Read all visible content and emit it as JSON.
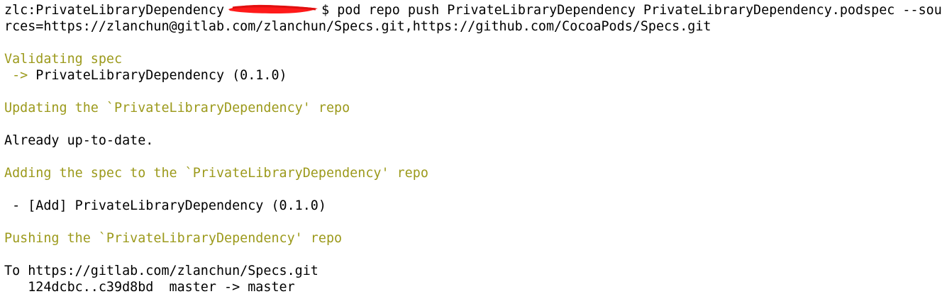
{
  "colors": {
    "background": "#ffffff",
    "text": "#000000",
    "status_text": "#9c9a1c",
    "redaction": "#ff1a1a"
  },
  "prompt": {
    "prefix": "zlc:PrivateLibraryDependency ",
    "suffix": "$ pod repo push PrivateLibraryDependency PrivateLibraryDependency.podspec --sou"
  },
  "lines": {
    "l2": "rces=https://zlanchun@gitlab.com/zlanchun/Specs.git,https://github.com/CocoaPods/Specs.git",
    "l4": "Validating spec",
    "l5_arrow": " ->",
    "l5_text": " PrivateLibraryDependency (0.1.0)",
    "l7": "Updating the `PrivateLibraryDependency' repo",
    "l9": "Already up-to-date.",
    "l11": "Adding the spec to the `PrivateLibraryDependency' repo",
    "l13": " - [Add] PrivateLibraryDependency (0.1.0)",
    "l15": "Pushing the `PrivateLibraryDependency' repo",
    "l17": "To https://gitlab.com/zlanchun/Specs.git",
    "l18": "   124dcbc..c39d8bd  master -> master"
  }
}
